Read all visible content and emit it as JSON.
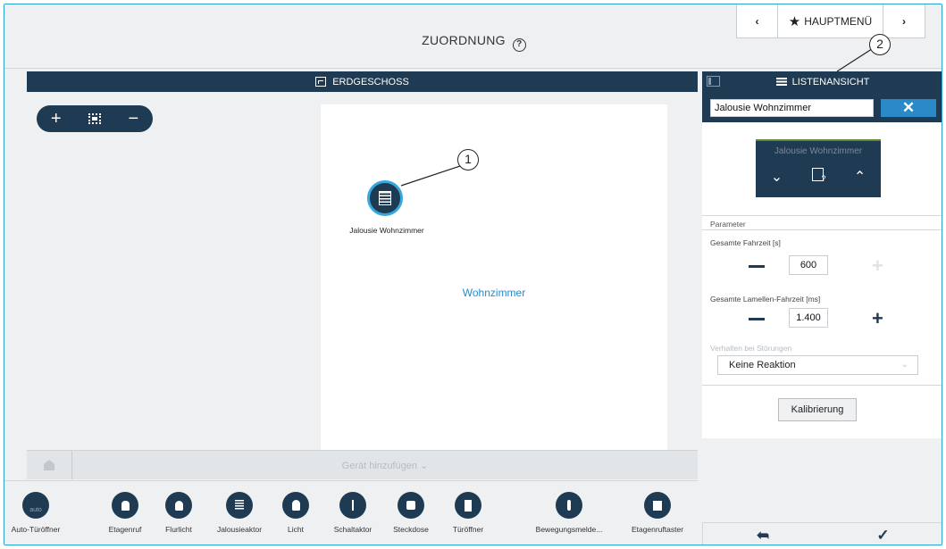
{
  "header": {
    "title": "ZUORDNUNG",
    "help_icon": "?",
    "nav_prev": "‹",
    "main_menu": "HAUPTMENÜ",
    "nav_next": "›"
  },
  "floor": {
    "title": "ERDGESCHOSS",
    "zoom_in": "+",
    "zoom_out": "−"
  },
  "canvas": {
    "room_name": "Wohnzimmer",
    "device_label": "Jalousie Wohnzimmer"
  },
  "callouts": [
    "1",
    "2"
  ],
  "add_bar": {
    "label": "Gerät hinzufügen ⌄"
  },
  "palette": {
    "items": [
      {
        "label": "Auto-Türöffner",
        "icon": "key-auto-icon",
        "badge": "auto"
      },
      {
        "label": "Etagenruf",
        "icon": "bell-icon"
      },
      {
        "label": "Flurlicht",
        "icon": "hall-light-icon"
      },
      {
        "label": "Jalousieaktor",
        "icon": "blind-icon"
      },
      {
        "label": "Licht",
        "icon": "bulb-icon"
      },
      {
        "label": "Schaltaktor",
        "icon": "switch-icon"
      },
      {
        "label": "Steckdose",
        "icon": "socket-icon"
      },
      {
        "label": "Türöffner",
        "icon": "door-icon"
      },
      {
        "label": "Bewegungsmelde...",
        "icon": "motion-icon"
      },
      {
        "label": "Etagenruftaster",
        "icon": "call-button-icon"
      }
    ]
  },
  "right_panel": {
    "header": "LISTENANSICHT",
    "device_name_value": "Jalousie Wohnzimmer",
    "close": "✕",
    "tile_name": "Jalousie Wohnzimmer",
    "tile_down": "⌄",
    "tile_up": "⌃",
    "params_header": "Parameter",
    "param1_label": "Gesamte Fahrzeit [s]",
    "param1_value": "600",
    "param2_label": "Gesamte Lamellen-Fahrzeit [ms]",
    "param2_value": "1.400",
    "plus": "+",
    "fault_label": "Verhalten bei Störungen",
    "fault_value": "Keine Reaktion",
    "calibrate": "Kalibrierung",
    "back": "➦",
    "confirm": "✓"
  },
  "colors": {
    "dark_navy": "#1f3a53",
    "accent_blue": "#2a8ac8",
    "background": "#eef0f2"
  }
}
